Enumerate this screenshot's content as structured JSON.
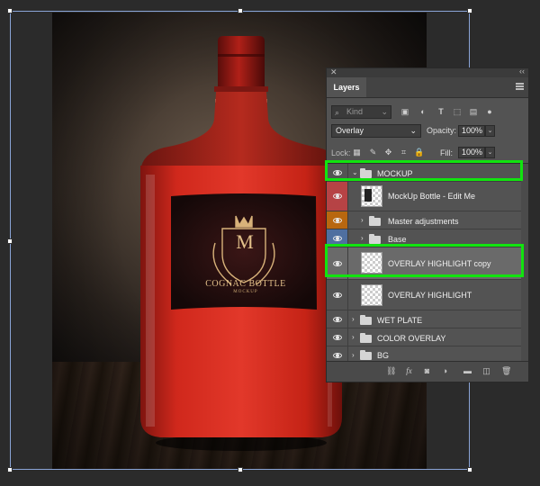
{
  "panel": {
    "title": "Layers",
    "close_glyph": "✕",
    "collapse_glyph": "‹‹",
    "filter": {
      "kind_placeholder": "Kind"
    },
    "blend_mode": "Overlay",
    "opacity_label": "Opacity:",
    "opacity_value": "100%",
    "lock_label": "Lock:",
    "fill_label": "Fill:",
    "fill_value": "100%"
  },
  "layers": [
    {
      "name": "MOCKUP",
      "type": "group",
      "expanded": true,
      "indent": 0,
      "eye_color": "#535353"
    },
    {
      "name": "MockUp Bottle - Edit Me",
      "type": "smart-object",
      "indent": 1,
      "eye_color": "#b64345"
    },
    {
      "name": "Master adjustments",
      "type": "group",
      "indent": 1,
      "eye_color": "#b8670f"
    },
    {
      "name": "Base",
      "type": "group",
      "indent": 1,
      "eye_color": "#4f6fa0"
    },
    {
      "name": "OVERLAY HIGHLIGHT copy",
      "type": "layer",
      "indent": 0,
      "eye_color": "#535353",
      "selected": true
    },
    {
      "name": "OVERLAY HIGHLIGHT",
      "type": "layer",
      "indent": 0,
      "eye_color": "#535353"
    },
    {
      "name": "WET PLATE",
      "type": "group",
      "indent": 0,
      "eye_color": "#535353"
    },
    {
      "name": "COLOR OVERLAY",
      "type": "group",
      "indent": 0,
      "eye_color": "#535353"
    },
    {
      "name": "BG",
      "type": "group",
      "indent": 0,
      "eye_color": "#535353"
    }
  ],
  "label": {
    "monogram": "M",
    "brand": "COGNAC BOTTLE",
    "sub": "MOCKUP"
  },
  "colors": {
    "highlight": "#11e40f",
    "liquid": "#c8241a"
  },
  "icons": {
    "filter": [
      "image-filter-icon",
      "adjustment-filter-icon",
      "type-filter-icon",
      "shape-filter-icon",
      "smartobject-filter-icon",
      "filter-toggle-icon"
    ],
    "lock": [
      "lock-transparent-icon",
      "lock-image-icon",
      "lock-position-icon",
      "lock-artboard-icon",
      "lock-all-icon"
    ],
    "footer": [
      "link-layers-icon",
      "fx-icon",
      "add-mask-icon",
      "new-adjustment-icon",
      "new-group-icon",
      "new-layer-icon",
      "delete-layer-icon"
    ]
  }
}
